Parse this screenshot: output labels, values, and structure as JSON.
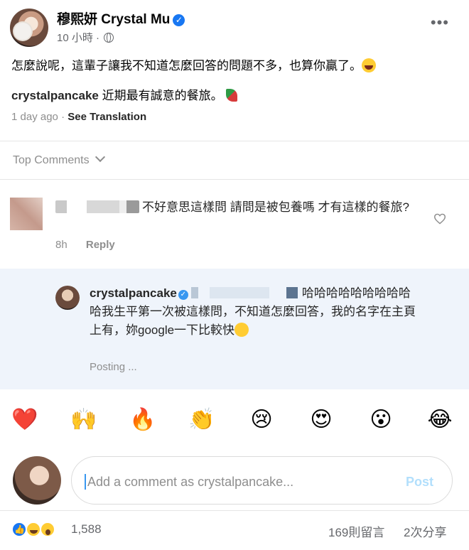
{
  "fb_post": {
    "author_name": "穆熙妍 Crystal Mu",
    "time": "10 小時",
    "meta_sep": "·",
    "more_icon": "more-horizontal-icon",
    "caption": "怎麼說呢，這輩子讓我不知道怎麼回答的問題不多，也算你贏了。"
  },
  "ig_post": {
    "username": "crystalpancake",
    "caption": "近期最有誠意的餐旅。",
    "time_ago": "1 day ago",
    "sep": "·",
    "see_translation": "See Translation",
    "top_comments_label": "Top Comments"
  },
  "comment": {
    "text": "不好意思這樣問 請問是被包養嗎 才有這樣的餐旅?",
    "time": "8h",
    "reply_label": "Reply"
  },
  "reply": {
    "username": "crystalpancake",
    "text_part1": "哈哈哈哈哈",
    "text_part2": "哈哈哈哈哈我生平第一次被這樣問，不知道怎麼回答，我的名字在主頁上有，妳google一下比較快",
    "status": "Posting ..."
  },
  "reactions": [
    "❤️",
    "🙌",
    "🔥",
    "👏",
    "😢",
    "😍",
    "😮",
    "😂"
  ],
  "comment_bar": {
    "placeholder": "Add a comment as crystalpancake...",
    "post_label": "Post"
  },
  "footer": {
    "reaction_count": "1,588",
    "comments": "169則留言",
    "shares": "2次分享"
  },
  "colors": {
    "facebook_blue": "#1877f2",
    "ig_blue": "#3897f0",
    "reply_bg": "#eff4fb",
    "muted_text": "#8e8e8e"
  }
}
